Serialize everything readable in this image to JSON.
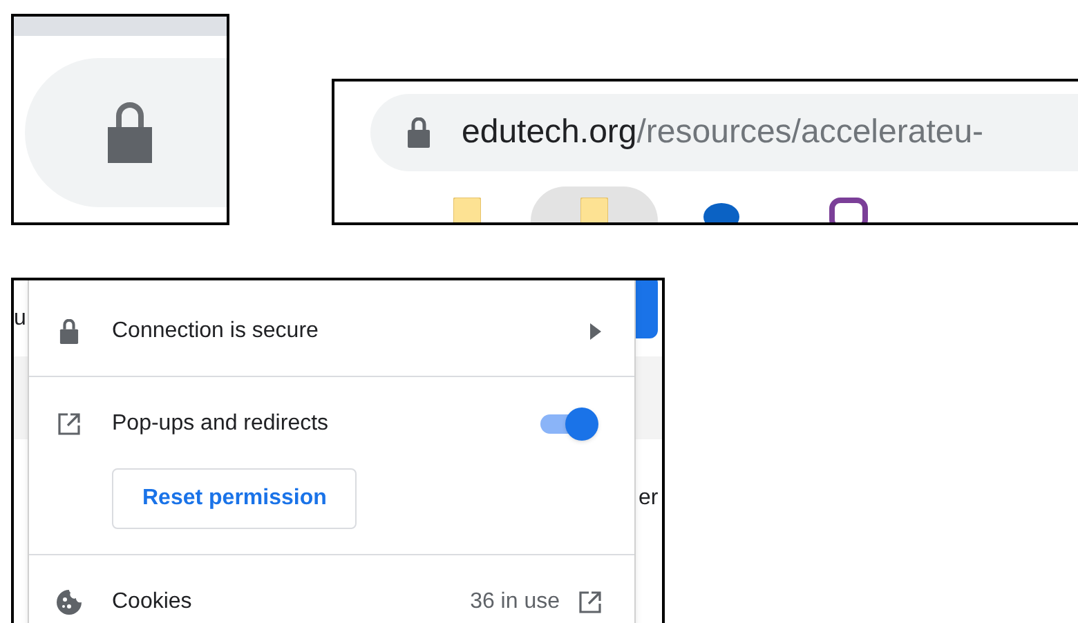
{
  "address_bar": {
    "host": "edutech.org",
    "path": "/resources/accelerateu-"
  },
  "bookmarks": [
    {
      "kind": "folder",
      "selected": false
    },
    {
      "kind": "folder",
      "selected": true
    },
    {
      "kind": "cloud",
      "selected": false
    },
    {
      "kind": "app",
      "selected": false
    }
  ],
  "background_texts": [
    "u",
    "er"
  ],
  "site_info": {
    "rows": [
      {
        "kind": "link",
        "label": "Connection is secure"
      },
      {
        "kind": "toggle",
        "label": "Pop-ups and redirects",
        "on": true,
        "button": "Reset permission"
      },
      {
        "kind": "cookies",
        "label": "Cookies",
        "count": "36 in use"
      }
    ]
  }
}
